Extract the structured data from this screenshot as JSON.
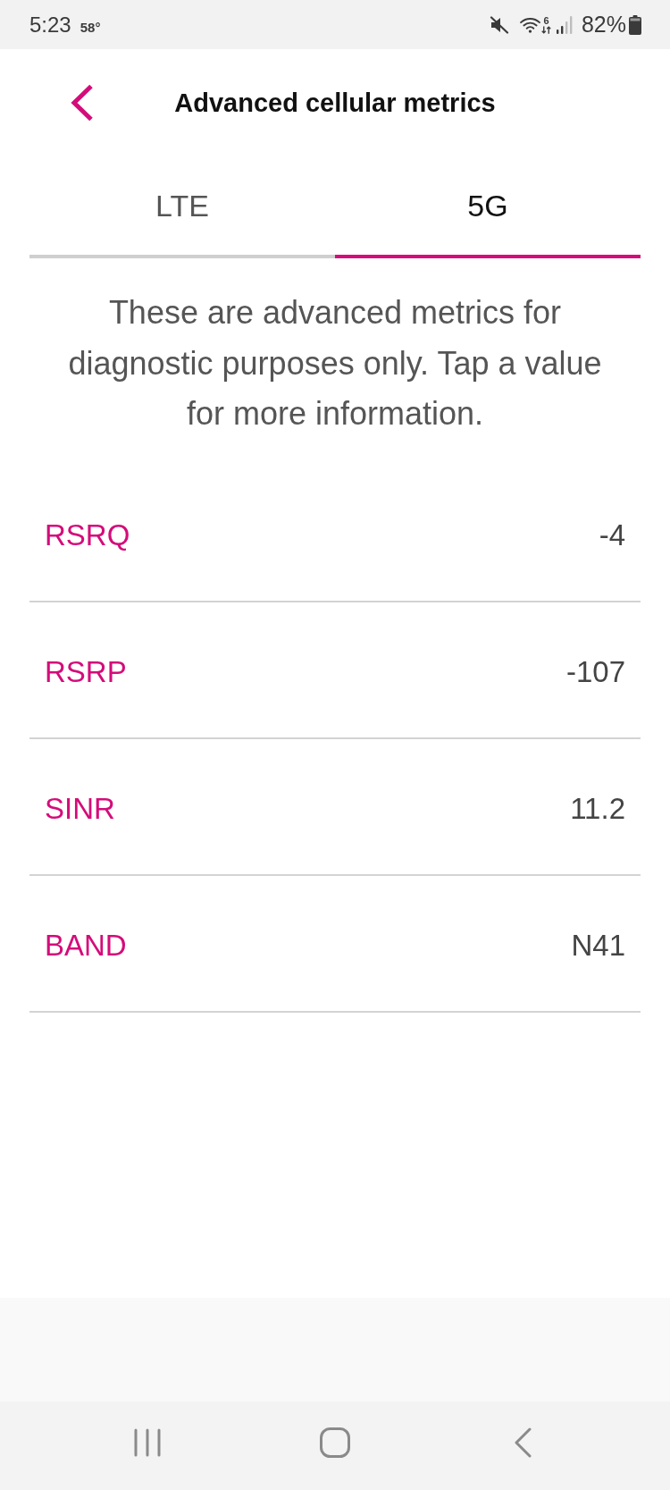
{
  "status_bar": {
    "time": "5:23",
    "temperature": "58°",
    "wifi_generation": "6",
    "battery": "82%"
  },
  "header": {
    "title": "Advanced cellular metrics"
  },
  "tabs": [
    {
      "label": "LTE",
      "selected": false
    },
    {
      "label": "5G",
      "selected": true
    }
  ],
  "description": "These are advanced metrics for diagnostic purposes only. Tap a value for more information.",
  "metrics": [
    {
      "label": "RSRQ",
      "value": "-4"
    },
    {
      "label": "RSRP",
      "value": "-107"
    },
    {
      "label": "SINR",
      "value": "11.2"
    },
    {
      "label": "BAND",
      "value": "N41"
    }
  ]
}
